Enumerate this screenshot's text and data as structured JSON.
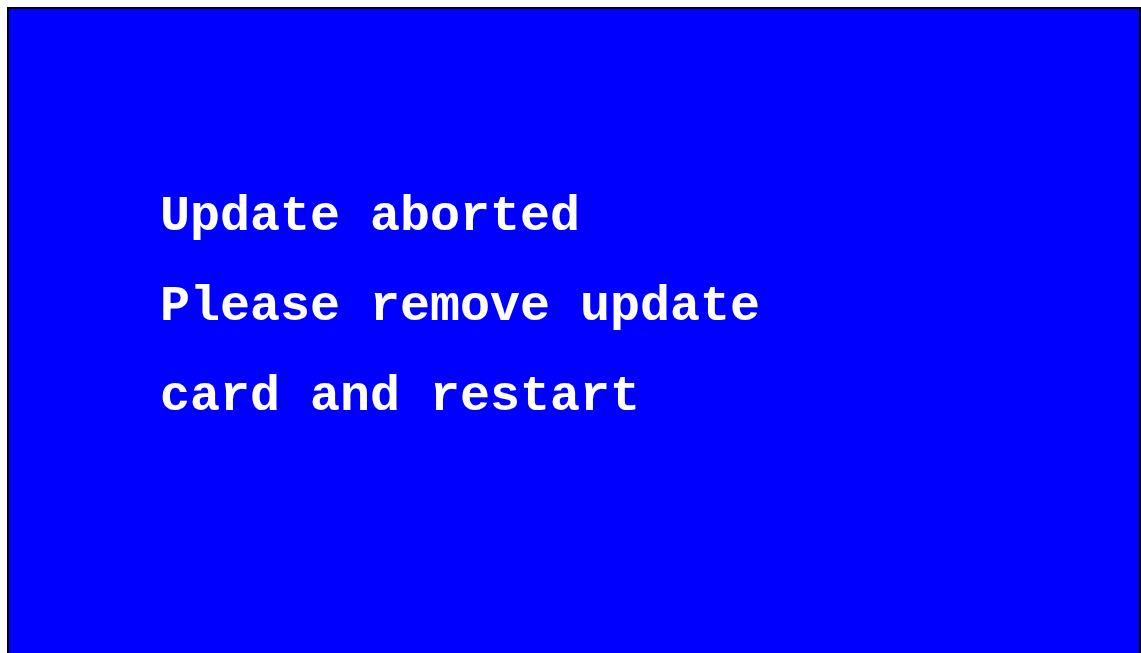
{
  "message_lines": [
    "Update aborted",
    "Please remove update",
    "card and restart"
  ]
}
